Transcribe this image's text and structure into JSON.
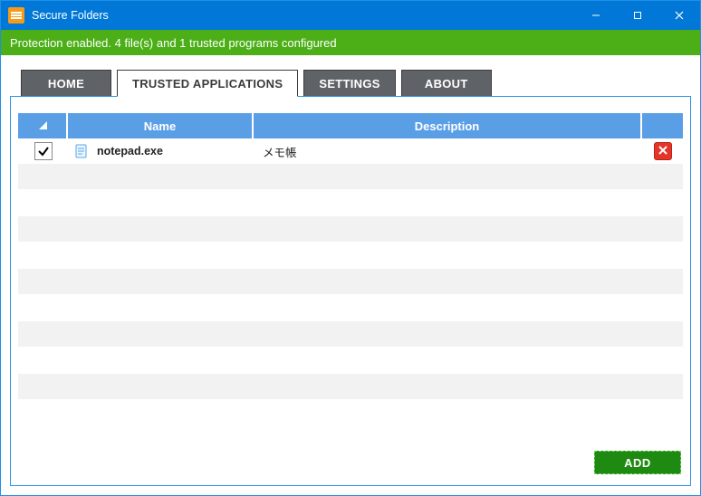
{
  "window": {
    "title": "Secure Folders"
  },
  "status": {
    "text": "Protection enabled. 4 file(s) and 1 trusted programs configured"
  },
  "tabs": {
    "home": "HOME",
    "trusted": "TRUSTED APPLICATIONS",
    "settings": "SETTINGS",
    "about": "ABOUT"
  },
  "columns": {
    "name": "Name",
    "description": "Description"
  },
  "rows": [
    {
      "checked": true,
      "name": "notepad.exe",
      "description": "メモ帳"
    }
  ],
  "buttons": {
    "add": "ADD"
  }
}
